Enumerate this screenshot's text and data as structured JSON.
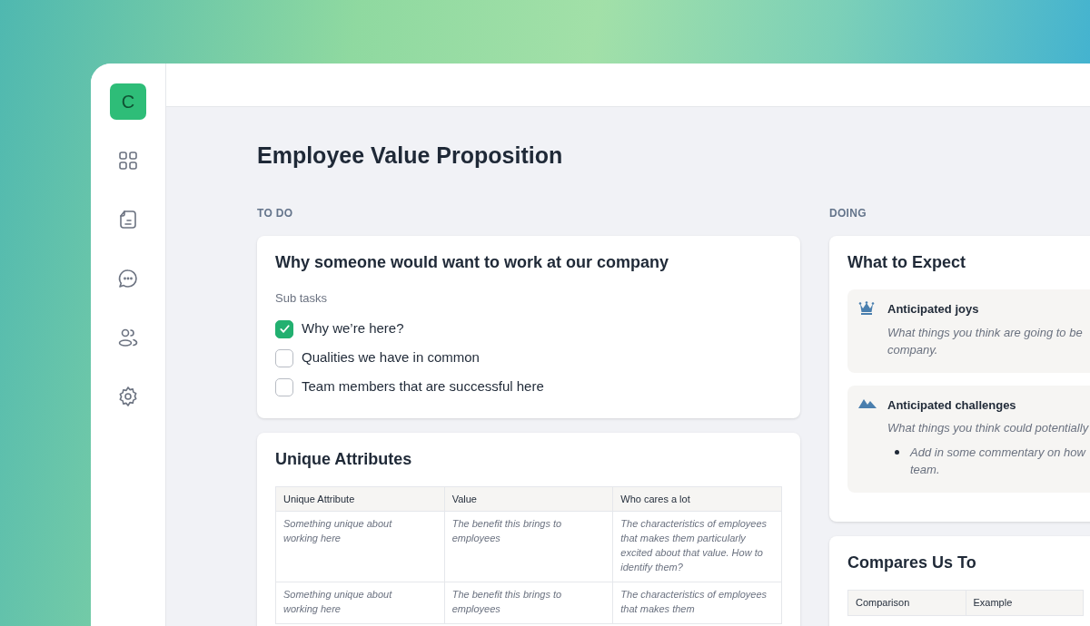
{
  "app": {
    "logo_letter": "C"
  },
  "page": {
    "title": "Employee Value Proposition"
  },
  "columns": [
    {
      "heading": "TO DO",
      "cards": [
        {
          "kind": "subtasks",
          "title": "Why someone would want to work at our company",
          "subtasks_label": "Sub tasks",
          "subtasks": [
            {
              "label": "Why we’re here?",
              "checked": true
            },
            {
              "label": "Qualities we have in common",
              "checked": false
            },
            {
              "label": "Team members that are successful here",
              "checked": false
            }
          ]
        },
        {
          "kind": "table",
          "title": "Unique Attributes",
          "table": {
            "columns": [
              "Unique Attribute",
              "Value",
              "Who cares a lot"
            ],
            "rows": [
              [
                "Something unique about working here",
                "The benefit this brings to employees",
                "The characteristics of employees that makes them particularly excited about that value. How to identify them?"
              ],
              [
                "Something unique about working here",
                "The benefit this brings to employees",
                "The characteristics of employees that makes them"
              ]
            ]
          }
        }
      ]
    },
    {
      "heading": "DOING",
      "cards": [
        {
          "kind": "callouts",
          "title": "What to Expect",
          "callouts": [
            {
              "title": "Anticipated joys",
              "lines": [
                "What things you think are going to be",
                "company."
              ]
            },
            {
              "title": "Anticipated challenges",
              "lines": [
                "What things you think could potentially"
              ],
              "bullet_lines": [
                "Add in some commentary on how",
                "team."
              ]
            }
          ]
        },
        {
          "kind": "table",
          "title": "Compares Us To",
          "table": {
            "columns": [
              "Comparison",
              "Example"
            ]
          }
        }
      ]
    }
  ]
}
